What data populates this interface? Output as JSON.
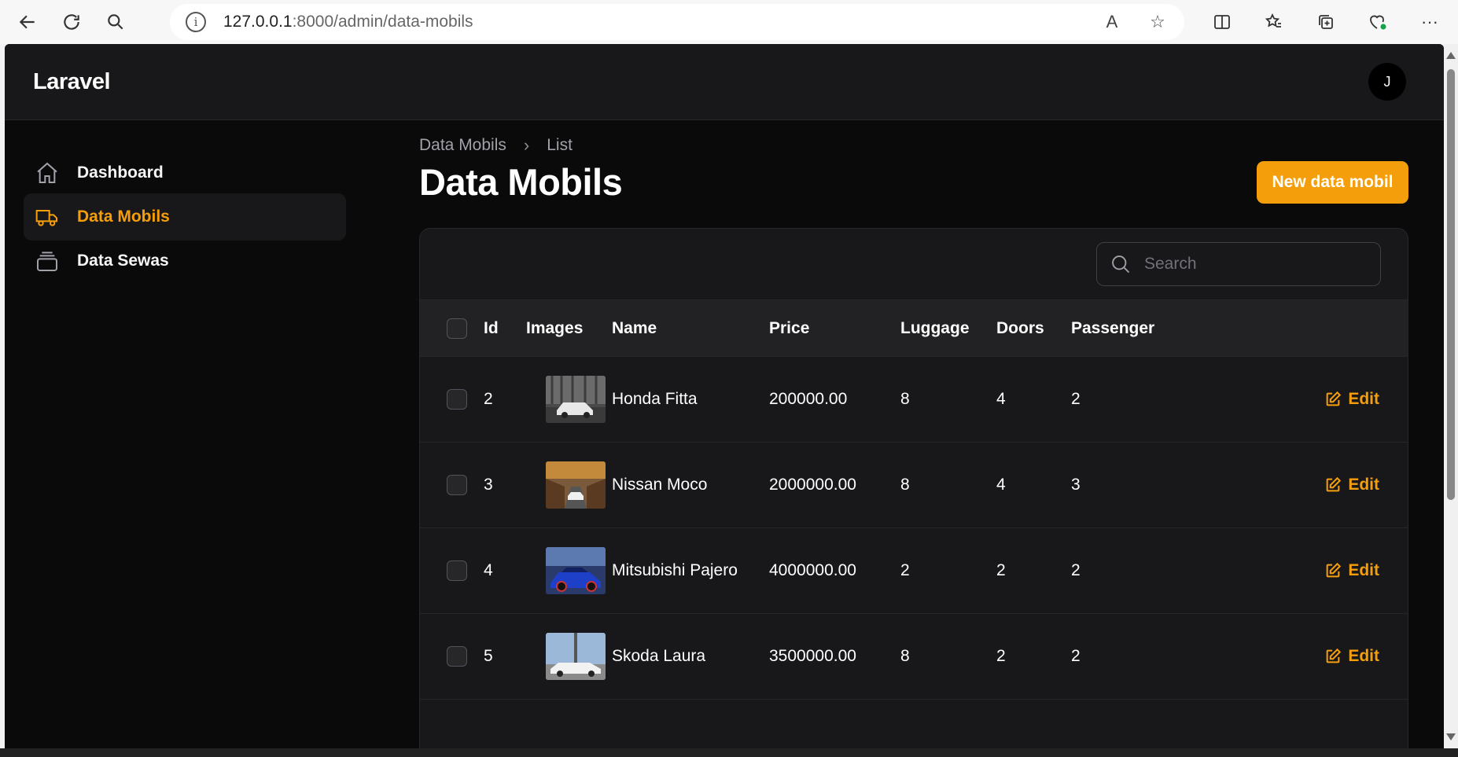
{
  "browser": {
    "url_host": "127.0.0.1",
    "url_rest": ":8000/admin/data-mobils"
  },
  "app": {
    "brand": "Laravel",
    "avatar_initial": "J"
  },
  "sidebar": {
    "items": [
      {
        "label": "Dashboard",
        "icon": "home-icon",
        "active": false
      },
      {
        "label": "Data Mobils",
        "icon": "truck-icon",
        "active": true
      },
      {
        "label": "Data Sewas",
        "icon": "stack-icon",
        "active": false
      }
    ]
  },
  "breadcrumb": {
    "first": "Data Mobils",
    "second": "List"
  },
  "page": {
    "title": "Data Mobils",
    "new_button": "New data mobil"
  },
  "search": {
    "placeholder": "Search"
  },
  "table": {
    "columns": [
      "Id",
      "Images",
      "Name",
      "Price",
      "Luggage",
      "Doors",
      "Passenger"
    ],
    "edit_label": "Edit",
    "rows": [
      {
        "id": "2",
        "name": "Honda Fitta",
        "price": "200000.00",
        "luggage": "8",
        "doors": "4",
        "passenger": "2"
      },
      {
        "id": "3",
        "name": "Nissan Moco",
        "price": "2000000.00",
        "luggage": "8",
        "doors": "4",
        "passenger": "3"
      },
      {
        "id": "4",
        "name": "Mitsubishi Pajero",
        "price": "4000000.00",
        "luggage": "2",
        "doors": "2",
        "passenger": "2"
      },
      {
        "id": "5",
        "name": "Skoda Laura",
        "price": "3500000.00",
        "luggage": "8",
        "doors": "2",
        "passenger": "2"
      }
    ]
  },
  "colors": {
    "accent": "#f59e0b",
    "background": "#0a0a0b",
    "panel": "#18181b"
  }
}
